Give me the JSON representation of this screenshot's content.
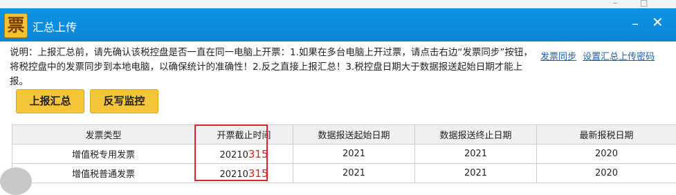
{
  "outer_window": {
    "minimize_glyph": "–",
    "restore_glyph": "□"
  },
  "window": {
    "icon_char": "票",
    "title": "汇总上传",
    "minimize_glyph": "–",
    "close_glyph": "✕"
  },
  "notice": "说明：上报汇总前，请先确认该税控盘是否一直在同一电脑上开票：1.如果在多台电脑上开过票，请点击右边“发票同步”按钮，将税控盘中的发票同步到本地电脑，以确保统计的准确性！2.反之直接上报汇总！3.税控盘日期大于数据报送起始日期才能上报。",
  "links": {
    "invoice_sync": "发票同步",
    "set_password": "设置汇总上传密码"
  },
  "buttons": {
    "upload_summary": "上报汇总",
    "writeback_monitor": "反写监控"
  },
  "table": {
    "headers": [
      "发票类型",
      "开票截止时间",
      "数据报送起始日期",
      "数据报送终止日期",
      "最新报税日期"
    ],
    "rows": [
      {
        "type": "增值税专用发票",
        "deadline_prefix": "20210",
        "deadline_mark": "315",
        "start_date": "2021",
        "end_date": "2021",
        "latest_date": "2020"
      },
      {
        "type": "增值税普通发票",
        "deadline_prefix": "20210",
        "deadline_mark": "315",
        "start_date": "2021",
        "end_date": "2021",
        "latest_date": "2020"
      }
    ]
  },
  "colors": {
    "titlebar": "#0f93e4",
    "button": "#f5c53a",
    "highlight": "#e02222",
    "link": "#1a5fb4"
  }
}
